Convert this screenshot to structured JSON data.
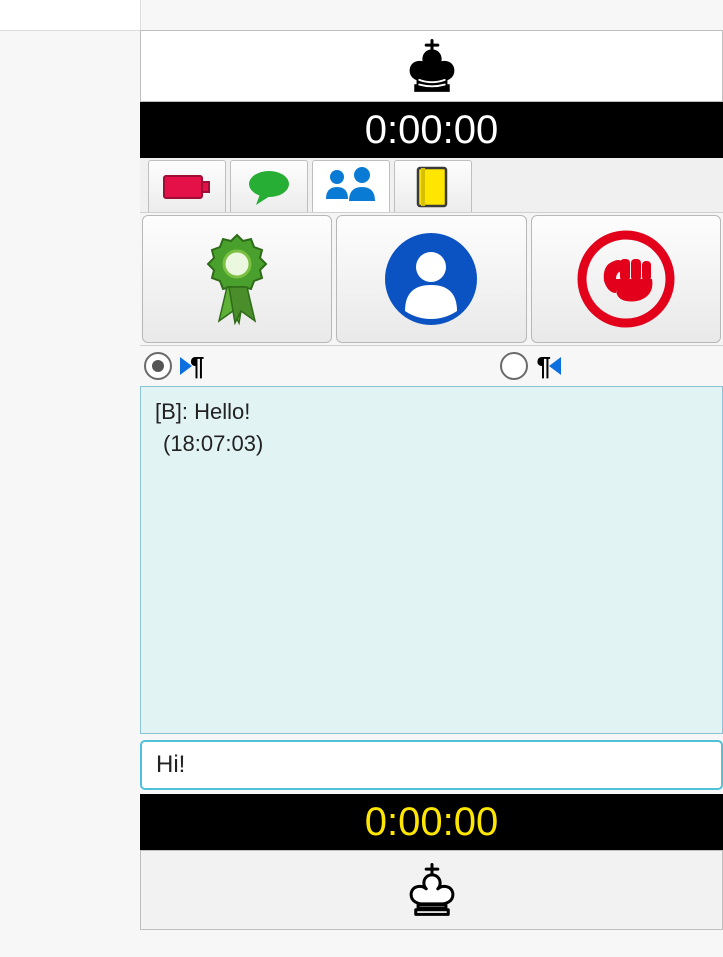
{
  "top_timer": "0:00:00",
  "bottom_timer": "0:00:00",
  "tabs": {
    "battery": "battery",
    "chat": "chat",
    "players": "players",
    "book": "book"
  },
  "big_buttons": {
    "award": "award",
    "profile": "profile",
    "fist": "fist"
  },
  "direction": {
    "left_selected": true,
    "right_selected": false
  },
  "chat": {
    "line1": "[B]: Hello!",
    "line2": "(18:07:03)"
  },
  "input_value": "Hi!"
}
